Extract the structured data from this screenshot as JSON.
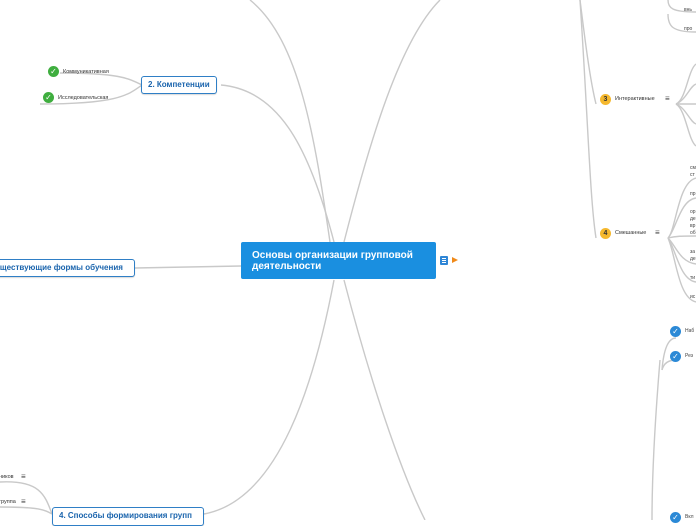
{
  "central": {
    "title": "Основы организации групповой деятельности"
  },
  "branches": {
    "competencies": "2. Компетенции",
    "forms": "существующие формы обучения",
    "groups": "4. Способы формирования групп"
  },
  "competencies_items": [
    "Коммуникативная",
    "Исследовательская"
  ],
  "right_items": {
    "interactive": {
      "number": "3",
      "label": "Интерактивные"
    },
    "mixed": {
      "number": "4",
      "label": "Смешанные"
    }
  },
  "top_right_fragments": [
    "внь",
    "про"
  ],
  "mixed_fragments": [
    "см",
    "ст",
    "пр",
    "ор",
    "де",
    "вр",
    "об",
    "за",
    "де",
    "ти",
    "ис"
  ],
  "bottom_right_items": [
    "Наб",
    "Рез",
    "Вкл"
  ],
  "left_bottom_fragments": [
    "ников",
    "группа"
  ],
  "icons": {
    "check": "check-icon",
    "menu": "menu-icon",
    "notes": "notes-icon",
    "arrow": "arrow-icon"
  },
  "colors": {
    "central_bg": "#1a8fe0",
    "branch_border": "#2f7fc6",
    "branch_text": "#1a64ad",
    "check_green": "#3fae3f",
    "check_blue": "#2b89d6",
    "number_badge": "#f5b82e",
    "connector": "#c8c8c8"
  }
}
